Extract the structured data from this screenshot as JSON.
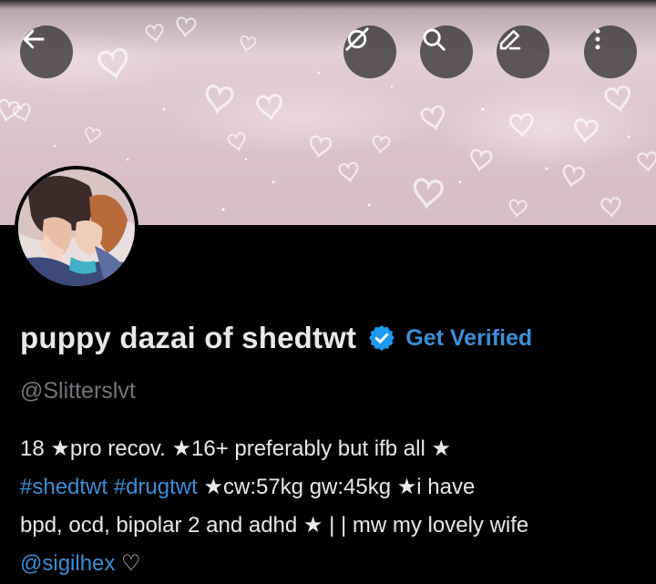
{
  "header": {
    "back_icon": "arrow-left-icon",
    "actions": [
      "satellite-off-icon",
      "search-icon",
      "edit-pencil-icon",
      "more-vertical-icon"
    ]
  },
  "profile": {
    "display_name": "puppy dazai of shedtwt",
    "verified_badge_icon": "verified-badge-icon",
    "get_verified_label": "Get Verified",
    "handle": "@Slitterslvt",
    "bio": {
      "line1": "18 ★pro recov. ★16+ preferably but ifb all ★",
      "hashtag1": "#shedtwt",
      "hashtag2": "#drugtwt",
      "line2_rest": "★cw:57kg gw:45kg ★i have",
      "line3": "bpd, ocd, bipolar 2 and adhd ★ | | mw my lovely wife",
      "mention": "@sigilhex",
      "line4_rest": "♡"
    }
  },
  "colors": {
    "background": "#000000",
    "text": "#e7e9ea",
    "secondary_text": "#71767b",
    "link": "#3a8fd9",
    "verified": "#1d9bf0"
  }
}
